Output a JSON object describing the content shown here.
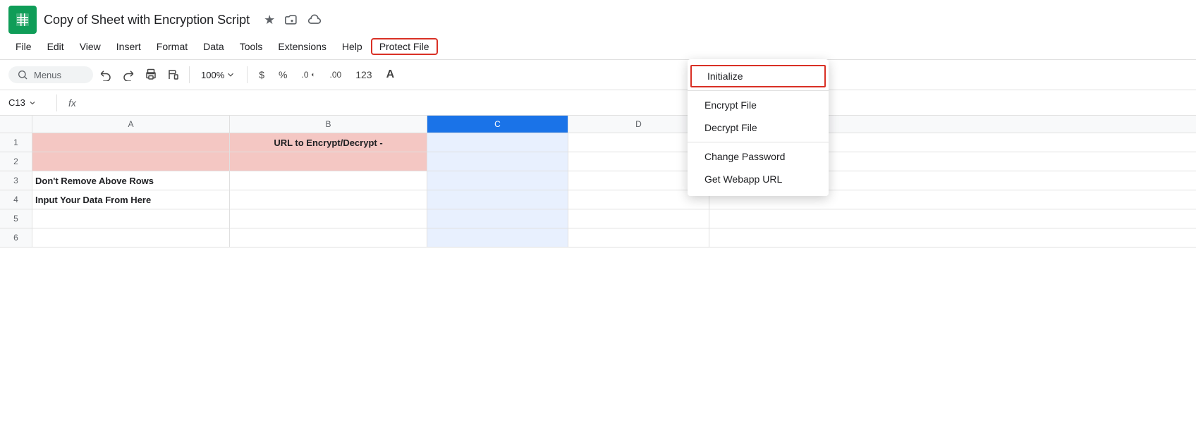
{
  "title_bar": {
    "doc_title": "Copy of Sheet with Encryption Script",
    "star_icon": "★",
    "folder_icon": "⊡",
    "cloud_icon": "☁"
  },
  "menu_bar": {
    "items": [
      {
        "label": "File",
        "id": "file"
      },
      {
        "label": "Edit",
        "id": "edit"
      },
      {
        "label": "View",
        "id": "view"
      },
      {
        "label": "Insert",
        "id": "insert"
      },
      {
        "label": "Format",
        "id": "format"
      },
      {
        "label": "Data",
        "id": "data"
      },
      {
        "label": "Tools",
        "id": "tools"
      },
      {
        "label": "Extensions",
        "id": "extensions"
      },
      {
        "label": "Help",
        "id": "help"
      },
      {
        "label": "Protect File",
        "id": "protect-file"
      }
    ]
  },
  "toolbar": {
    "search_label": "Menus",
    "zoom": "100%",
    "currency": "$",
    "percent": "%",
    "decimal_less": ".0",
    "decimal_more": ".00",
    "format_123": "123",
    "format_a": "A"
  },
  "formula_bar": {
    "cell_ref": "C13",
    "formula_icon": "fx"
  },
  "columns": {
    "headers": [
      "A",
      "B",
      "C",
      "D"
    ]
  },
  "rows": [
    {
      "num": "1",
      "a": "",
      "b": "URL to Encrypt/Decrypt -",
      "c": "",
      "merged": true,
      "pink": true,
      "bold": true
    },
    {
      "num": "2",
      "a": "",
      "b": "",
      "c": "",
      "pink": true
    },
    {
      "num": "3",
      "a": "Don't Remove Above Rows",
      "b": "",
      "c": "",
      "bold_a": true
    },
    {
      "num": "4",
      "a": "Input Your Data From Here",
      "b": "",
      "c": "",
      "bold_a": true
    },
    {
      "num": "5",
      "a": "",
      "b": "",
      "c": ""
    },
    {
      "num": "6",
      "a": "",
      "b": "",
      "c": ""
    }
  ],
  "dropdown": {
    "items": [
      {
        "label": "Initialize",
        "highlighted": true,
        "id": "initialize"
      },
      {
        "label": "Encrypt File",
        "id": "encrypt-file"
      },
      {
        "label": "Decrypt File",
        "id": "decrypt-file"
      },
      {
        "label": "Change Password",
        "id": "change-password"
      },
      {
        "label": "Get Webapp URL",
        "id": "get-webapp-url"
      }
    ]
  }
}
